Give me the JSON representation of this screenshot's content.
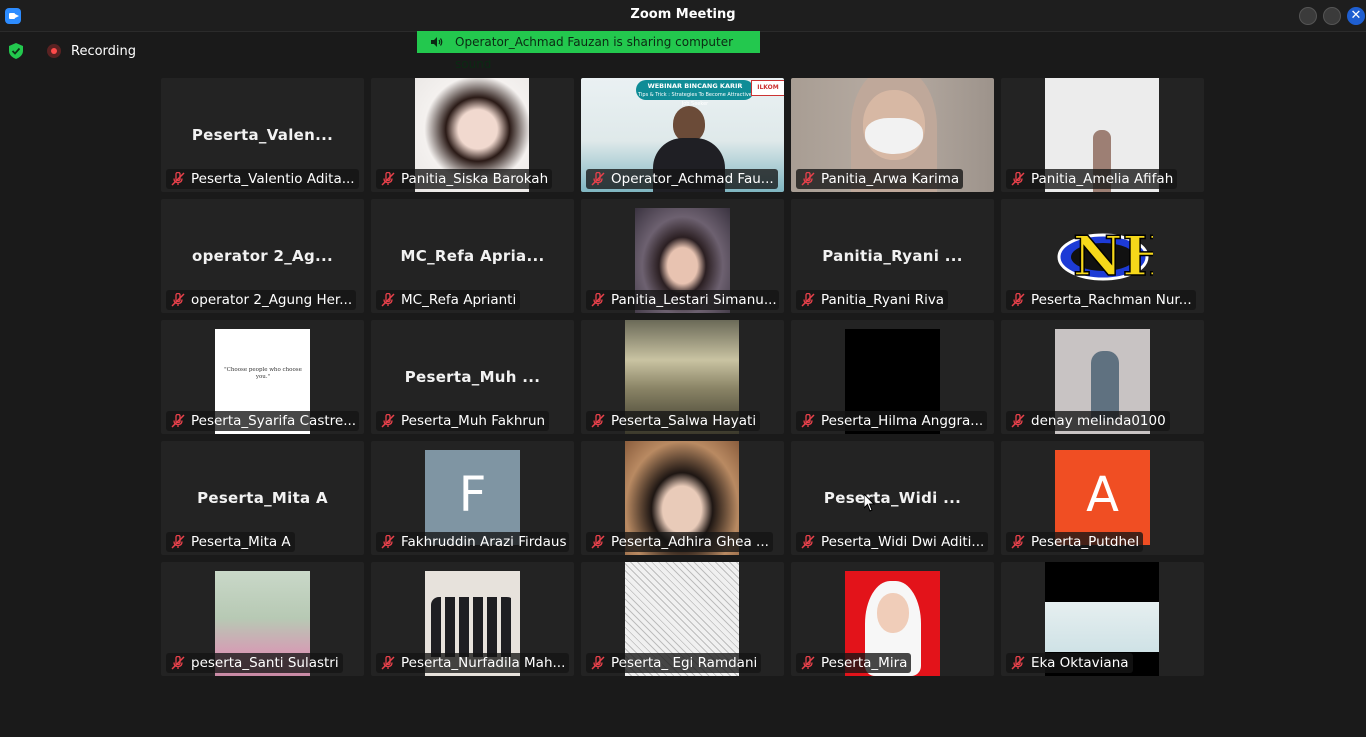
{
  "window": {
    "title": "Zoom Meeting",
    "close_glyph": "✕"
  },
  "status": {
    "recording_label": "Recording"
  },
  "banner": {
    "text": "Operator_Achmad Fauzan is sharing computer sound"
  },
  "tiles": [
    {
      "name": "Peserta_Valentio Adita...",
      "label": "Peserta_Valen...",
      "video": "none"
    },
    {
      "name": "Panitia_Siska Barokah",
      "video": "photo-woman"
    },
    {
      "name": "Operator_Achmad Fau...",
      "video": "webinar-banner",
      "banner_title": "WEBINAR BINCANG KARIR",
      "banner_subtitle": "Tips & Trick : Strategies To Become Attractive Job Seeker"
    },
    {
      "name": "Panitia_Arwa Karima",
      "video": "camera-mask"
    },
    {
      "name": "Panitia_Amelia Afifah",
      "video": "photo-hijab"
    },
    {
      "name": "operator 2_Agung Her...",
      "label": "operator 2_Ag...",
      "video": "none"
    },
    {
      "name": "MC_Refa Aprianti",
      "label": "MC_Refa Apria...",
      "video": "none"
    },
    {
      "name": "Panitia_Lestari Simanu...",
      "video": "photo-selfie"
    },
    {
      "name": "Panitia_Ryani Riva",
      "label": "Panitia_Ryani ...",
      "video": "none"
    },
    {
      "name": "Peserta_Rachman Nur...",
      "video": "logo-nh"
    },
    {
      "name": "Peserta_Syarifa Castre...",
      "video": "quote-card",
      "quote": "\"Choose people who choose you.\""
    },
    {
      "name": "Peserta_Muh Fakhrun",
      "label": "Peserta_Muh ...",
      "video": "none"
    },
    {
      "name": "Peserta_Salwa Hayati",
      "video": "photo-sky"
    },
    {
      "name": "Peserta_Hilma Anggra...",
      "video": "black"
    },
    {
      "name": "denay melinda0100",
      "video": "photo-hijab-gray"
    },
    {
      "name": "Peserta_Mita A",
      "label": "Peserta_Mita A",
      "video": "none"
    },
    {
      "name": "Fakhruddin Arazi Firdaus",
      "video": "avatar",
      "avatar_letter": "F",
      "avatar_color": "#7f95a3"
    },
    {
      "name": "Peserta_Adhira Ghea ...",
      "video": "photo-girl"
    },
    {
      "name": "Peserta_Widi Dwi Aditi...",
      "label": "Peserta_Widi ...",
      "video": "none"
    },
    {
      "name": "Peserta_Putdhel",
      "video": "avatar",
      "avatar_letter": "A",
      "avatar_color": "#f04e23"
    },
    {
      "name": "peserta_Santi Sulastri",
      "video": "photo-pink"
    },
    {
      "name": "Peserta_Nurfadila Mah...",
      "video": "photo-group"
    },
    {
      "name": "Peserta_ Egi Ramdani",
      "video": "photo-sketch"
    },
    {
      "name": "Peserta_Mira",
      "video": "photo-red"
    },
    {
      "name": "Eka Oktaviana",
      "video": "webinar-small"
    }
  ],
  "colors": {
    "accent_green": "#23c84e",
    "mute_red": "#e8414b",
    "zoom_blue": "#2d8cff"
  }
}
